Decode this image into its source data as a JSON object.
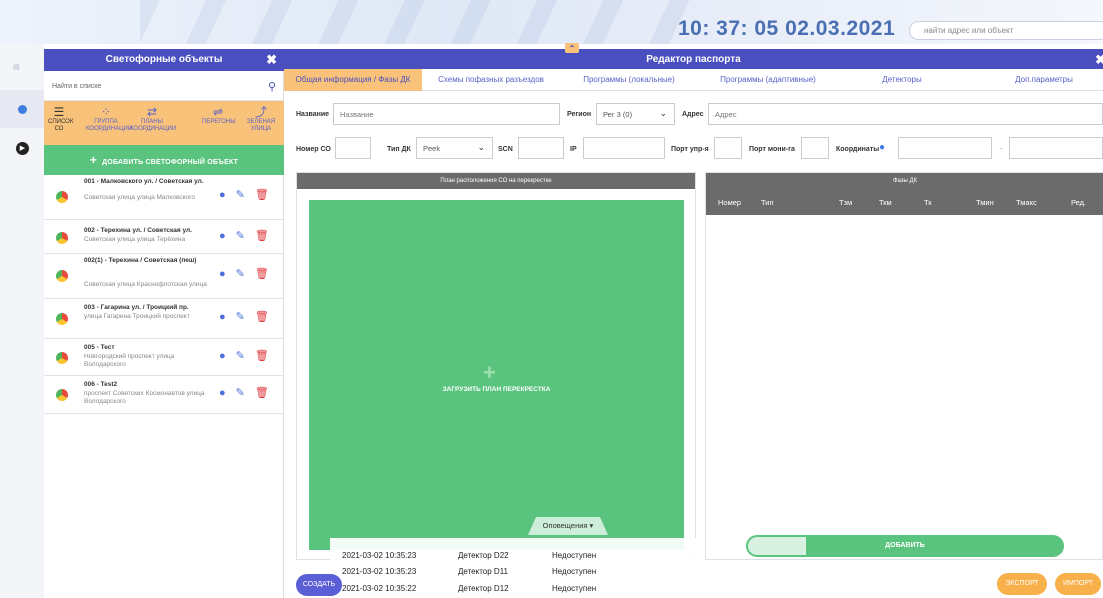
{
  "header": {
    "clock": "10: 37: 05  02.03.2021",
    "search_placeholder": "найти адрес или объект"
  },
  "left_panel": {
    "title": "Светофорные объекты",
    "search_placeholder": "Найти в списке",
    "tools": [
      {
        "label": "СПИСОК СО",
        "icon": "list-icon"
      },
      {
        "label": "ГРУППА КООРДИНАЦИИ",
        "icon": "group-icon"
      },
      {
        "label": "ПЛАНЫ КООРДИНАЦИИ",
        "icon": "plans-icon"
      },
      {
        "label": "ПЕРЕГОНЫ",
        "icon": "stages-icon"
      },
      {
        "label": "ЗЕЛЕНАЯ УЛИЦА",
        "icon": "green-wave-icon"
      }
    ],
    "add_button": "ДОБАВИТЬ СВЕТОФОРНЫЙ ОБЪЕКТ",
    "items": [
      {
        "title": "001 - Малковского ул. / Советская ул.",
        "subtitle": "Советская улица улица Малковского"
      },
      {
        "title": "002 - Терехина ул. / Советская ул.",
        "subtitle": "Советская улица улица Терёхина"
      },
      {
        "title": "002(1) - Терехина / Советская (пеш)",
        "subtitle": "Советская улица Краснофлотская улица"
      },
      {
        "title": "003 - Гагарина ул. / Троицкий пр.",
        "subtitle": "улица Гагарина Троицкий проспект"
      },
      {
        "title": "005 - Тест",
        "subtitle": "Новгородский проспект улица Володарского"
      },
      {
        "title": "006 - Test2",
        "subtitle": "проспект Советских Космонавтов улица Володарского"
      }
    ]
  },
  "editor": {
    "title": "Редактор паспорта",
    "tabs": [
      "Общая информация / Фазы ДК",
      "Схемы пофазных разъездов",
      "Программы (локальные)",
      "Программы (адаптивные)",
      "Детекторы",
      "Доп.параметры"
    ],
    "form": {
      "name_label": "Название",
      "name_placeholder": "Название",
      "region_label": "Регион",
      "region_value": "Рег 3 (0)",
      "address_label": "Адрес",
      "address_placeholder": "Адрес",
      "number_label": "Номер СО",
      "type_label": "Тип ДК",
      "type_value": "Peek",
      "scn_label": "SCN",
      "ip_label": "IP",
      "port_ctrl_label": "Порт упр-я",
      "port_mon_label": "Порт мони-га",
      "coords_label": "Координаты",
      "coords_sep": "-"
    },
    "plan": {
      "header": "План расположения СО на перекрестке",
      "upload_label": "ЗАГРУЗИТЬ ПЛАН ПЕРЕКРЕСТКА"
    },
    "phases": {
      "header": "Фазы ДК",
      "columns": [
        "Номер",
        "Тип",
        "Тзм",
        "Ткм",
        "Тк",
        "Тмин",
        "Тмакс",
        "Ред."
      ],
      "add_button": "ДОБАВИТЬ"
    },
    "notifications": {
      "tab_label": "Оповещения ▾",
      "rows": [
        {
          "time": "2021-03-02 10:35:23",
          "source": "Детектор D22",
          "status": "Недоступен"
        },
        {
          "time": "2021-03-02 10:35:23",
          "source": "Детектор D11",
          "status": "Недоступен"
        },
        {
          "time": "2021-03-02 10:35:22",
          "source": "Детектор D12",
          "status": "Недоступен"
        }
      ]
    },
    "buttons": {
      "create": "СОЗДАТЬ",
      "export": "ЭКСПОРТ",
      "import": "ИМПОРТ"
    }
  }
}
